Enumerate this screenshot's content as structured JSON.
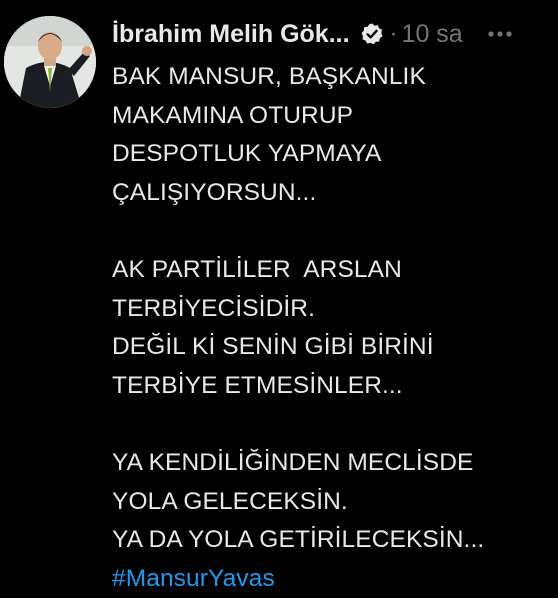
{
  "tweet": {
    "author_name": "İbrahim Melih Gök...",
    "dot": "·",
    "time": "10 sa",
    "lines": [
      "BAK MANSUR, BAŞKANLIK",
      "MAKAMINA OTURUP",
      "DESPOTLUK YAPMAYA",
      "ÇALIŞIYORSUN...",
      "",
      "AK PARTİLİLER  ARSLAN",
      "TERBİYECİSİDİR.",
      "DEĞİL Kİ SENİN GİBİ BİRİNİ",
      "TERBİYE ETMESİNLER...",
      "",
      "YA KENDİLİĞİNDEN MECLİSDE",
      "YOLA GELECEKSİN.",
      "YA DA YOLA GETİRİLECEKSİN..."
    ],
    "hashtag": "#MansurYavas"
  },
  "icons": {
    "verified": "verified-badge-icon",
    "more": "more-options-icon"
  },
  "colors": {
    "background": "#000000",
    "text": "#e7e9ea",
    "secondary": "#71767b",
    "link": "#1d9bf0"
  }
}
